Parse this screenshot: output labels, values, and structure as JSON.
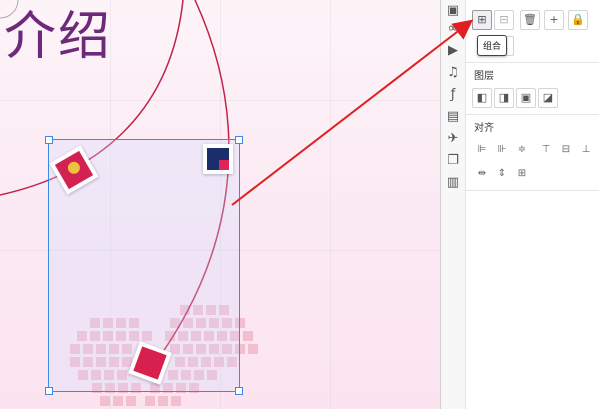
{
  "canvas": {
    "title": "介绍"
  },
  "tooltip": {
    "text": "组合"
  },
  "panel": {
    "layer_label": "图层",
    "align_label": "对齐"
  },
  "icons": {
    "sidebar": [
      "image-icon",
      "link-icon",
      "video-icon",
      "music-icon",
      "flash-icon",
      "document-icon",
      "plane-icon",
      "copy-icon",
      "layout-icon"
    ],
    "toolbar": [
      "group-icon",
      "ungroup-icon",
      "delete-icon",
      "add-icon",
      "lock-icon"
    ],
    "layer": [
      "bring-front-icon",
      "send-back-icon",
      "bring-forward-icon",
      "send-backward-icon"
    ],
    "align": [
      "align-left-icon",
      "align-right-icon",
      "align-center-h-icon",
      "align-top-icon",
      "align-middle-icon",
      "align-bottom-icon",
      "distribute-h-icon",
      "distribute-v-icon",
      "distribute-grid-icon"
    ]
  },
  "colors": {
    "accent_red": "#e02020",
    "selection_blue": "#3b8be6",
    "title_purple": "#6d2a7a",
    "photo_red": "#d8204f"
  }
}
